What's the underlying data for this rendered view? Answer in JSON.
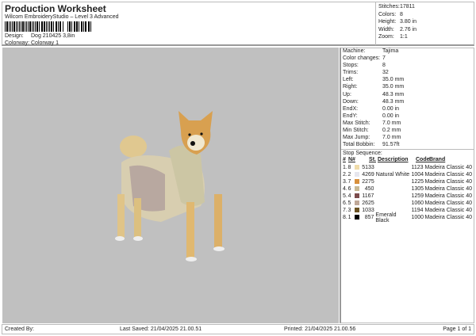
{
  "header": {
    "title": "Production Worksheet",
    "subtitle": "Wilcom EmbroideryStudio – Level 3 Advanced",
    "design_label": "Design:",
    "design": "Dog 210425 3,8in",
    "colorway_label": "Colorway:",
    "colorway": "Colorway 1"
  },
  "stats": [
    {
      "k": "Stitches:",
      "v": "17811"
    },
    {
      "k": "Colors:",
      "v": "8"
    },
    {
      "k": "Height:",
      "v": "3.80 in"
    },
    {
      "k": "Width:",
      "v": "2.76 in"
    },
    {
      "k": "Zoom:",
      "v": "1:1"
    }
  ],
  "props": [
    {
      "k": "Machine:",
      "v": "Tajima"
    },
    {
      "k": "Color changes:",
      "v": "7"
    },
    {
      "k": "Stops:",
      "v": "8"
    },
    {
      "k": "Trims:",
      "v": "32"
    },
    {
      "k": "Left:",
      "v": "35.0 mm"
    },
    {
      "k": "Right:",
      "v": "35.0 mm"
    },
    {
      "k": "Up:",
      "v": "48.3 mm"
    },
    {
      "k": "Down:",
      "v": "48.3 mm"
    },
    {
      "k": "EndX:",
      "v": "0.00 in"
    },
    {
      "k": "EndY:",
      "v": "0.00 in"
    },
    {
      "k": "Max Stitch:",
      "v": "7.0 mm"
    },
    {
      "k": "Min Stitch:",
      "v": "0.2 mm"
    },
    {
      "k": "Max Jump:",
      "v": "7.0 mm"
    },
    {
      "k": "Total Bobbin:",
      "v": "91.57ft"
    }
  ],
  "stop_sequence": {
    "label": "Stop Sequence:",
    "headers": [
      "#",
      "N#",
      "St.",
      "Description",
      "Code",
      "Brand"
    ],
    "rows": [
      {
        "n": "1.",
        "needle": "8",
        "color": "#f0dcaa",
        "st": "5133",
        "desc": "",
        "code": "1123",
        "brand": "Madeira Classic 40"
      },
      {
        "n": "2.",
        "needle": "2",
        "color": "#e6e6ee",
        "st": "4269",
        "desc": "Natural White",
        "code": "1004",
        "brand": "Madeira Classic 40"
      },
      {
        "n": "3.",
        "needle": "7",
        "color": "#d8903c",
        "st": "2275",
        "desc": "",
        "code": "1225",
        "brand": "Madeira Classic 40"
      },
      {
        "n": "4.",
        "needle": "6",
        "color": "#c8b894",
        "st": "450",
        "desc": "",
        "code": "1305",
        "brand": "Madeira Classic 40"
      },
      {
        "n": "5.",
        "needle": "4",
        "color": "#7c4c4c",
        "st": "1167",
        "desc": "",
        "code": "1259",
        "brand": "Madeira Classic 40"
      },
      {
        "n": "6.",
        "needle": "5",
        "color": "#c0a898",
        "st": "2625",
        "desc": "",
        "code": "1060",
        "brand": "Madeira Classic 40"
      },
      {
        "n": "7.",
        "needle": "3",
        "color": "#6c5424",
        "st": "1033",
        "desc": "",
        "code": "1194",
        "brand": "Madeira Classic 40"
      },
      {
        "n": "8.",
        "needle": "1",
        "color": "#000000",
        "st": "857",
        "desc": "Emerald Black",
        "code": "1000",
        "brand": "Madeira Classic 40"
      }
    ]
  },
  "footer": {
    "created": "Created By:",
    "saved": "Last Saved: 21/04/2025 21.00.51",
    "printed": "Printed: 21/04/2025 21.00.56",
    "page": "Page 1 of 1"
  }
}
